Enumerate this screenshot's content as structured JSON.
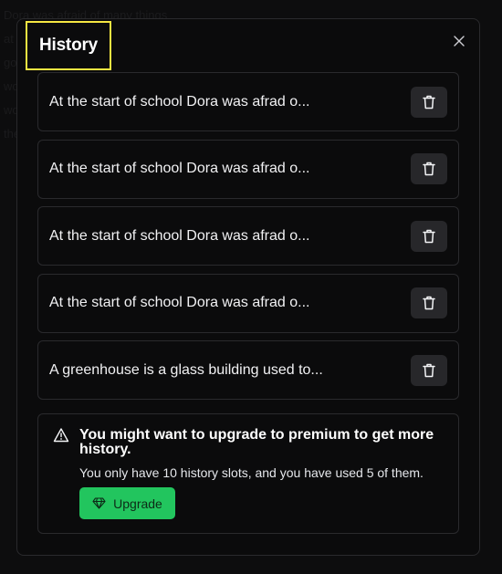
{
  "background": {
    "text": "Dora was afraid of many things\nat school she did not want to\ngo to class because she was\nworried that the other children\nwould not like her and that\nthe teacher would be strict."
  },
  "dialog": {
    "title": "History",
    "close_icon": "close-icon"
  },
  "history": {
    "items": [
      {
        "text": "At the start of school Dora was afrad o..."
      },
      {
        "text": "At the start of school Dora was afrad o..."
      },
      {
        "text": "At the start of school Dora was afrad o..."
      },
      {
        "text": "At the start of school Dora was afrad o..."
      },
      {
        "text": "A greenhouse is a glass building used to..."
      }
    ],
    "delete_icon": "trash-icon"
  },
  "notice": {
    "icon": "warning-triangle-icon",
    "title": "You might want to upgrade to premium to get more history.",
    "description": "You only have 10 history slots, and you have used 5 of them.",
    "button_label": "Upgrade",
    "button_icon": "gem-icon",
    "slots_total": 10,
    "slots_used": 5
  },
  "colors": {
    "highlight_border": "#f5e642",
    "accent": "#22c55e",
    "panel_border": "#2a2a2d",
    "button_bg": "#27272a"
  }
}
